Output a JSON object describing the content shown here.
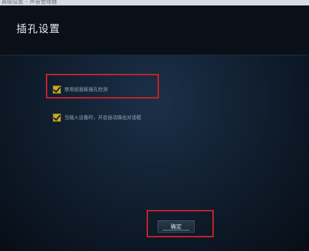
{
  "window": {
    "titlebar_text": "高级设置 – 声音管理器"
  },
  "header": {
    "title": "插孔设置"
  },
  "options": [
    {
      "label": "禁用前面板插孔检测",
      "checked": true
    },
    {
      "label": "当插入设备时，开启自动弹出对话框",
      "checked": true
    }
  ],
  "footer": {
    "ok_label": "确定"
  },
  "colors": {
    "highlight": "#d0202a",
    "checkbox": "#c9a92a"
  }
}
